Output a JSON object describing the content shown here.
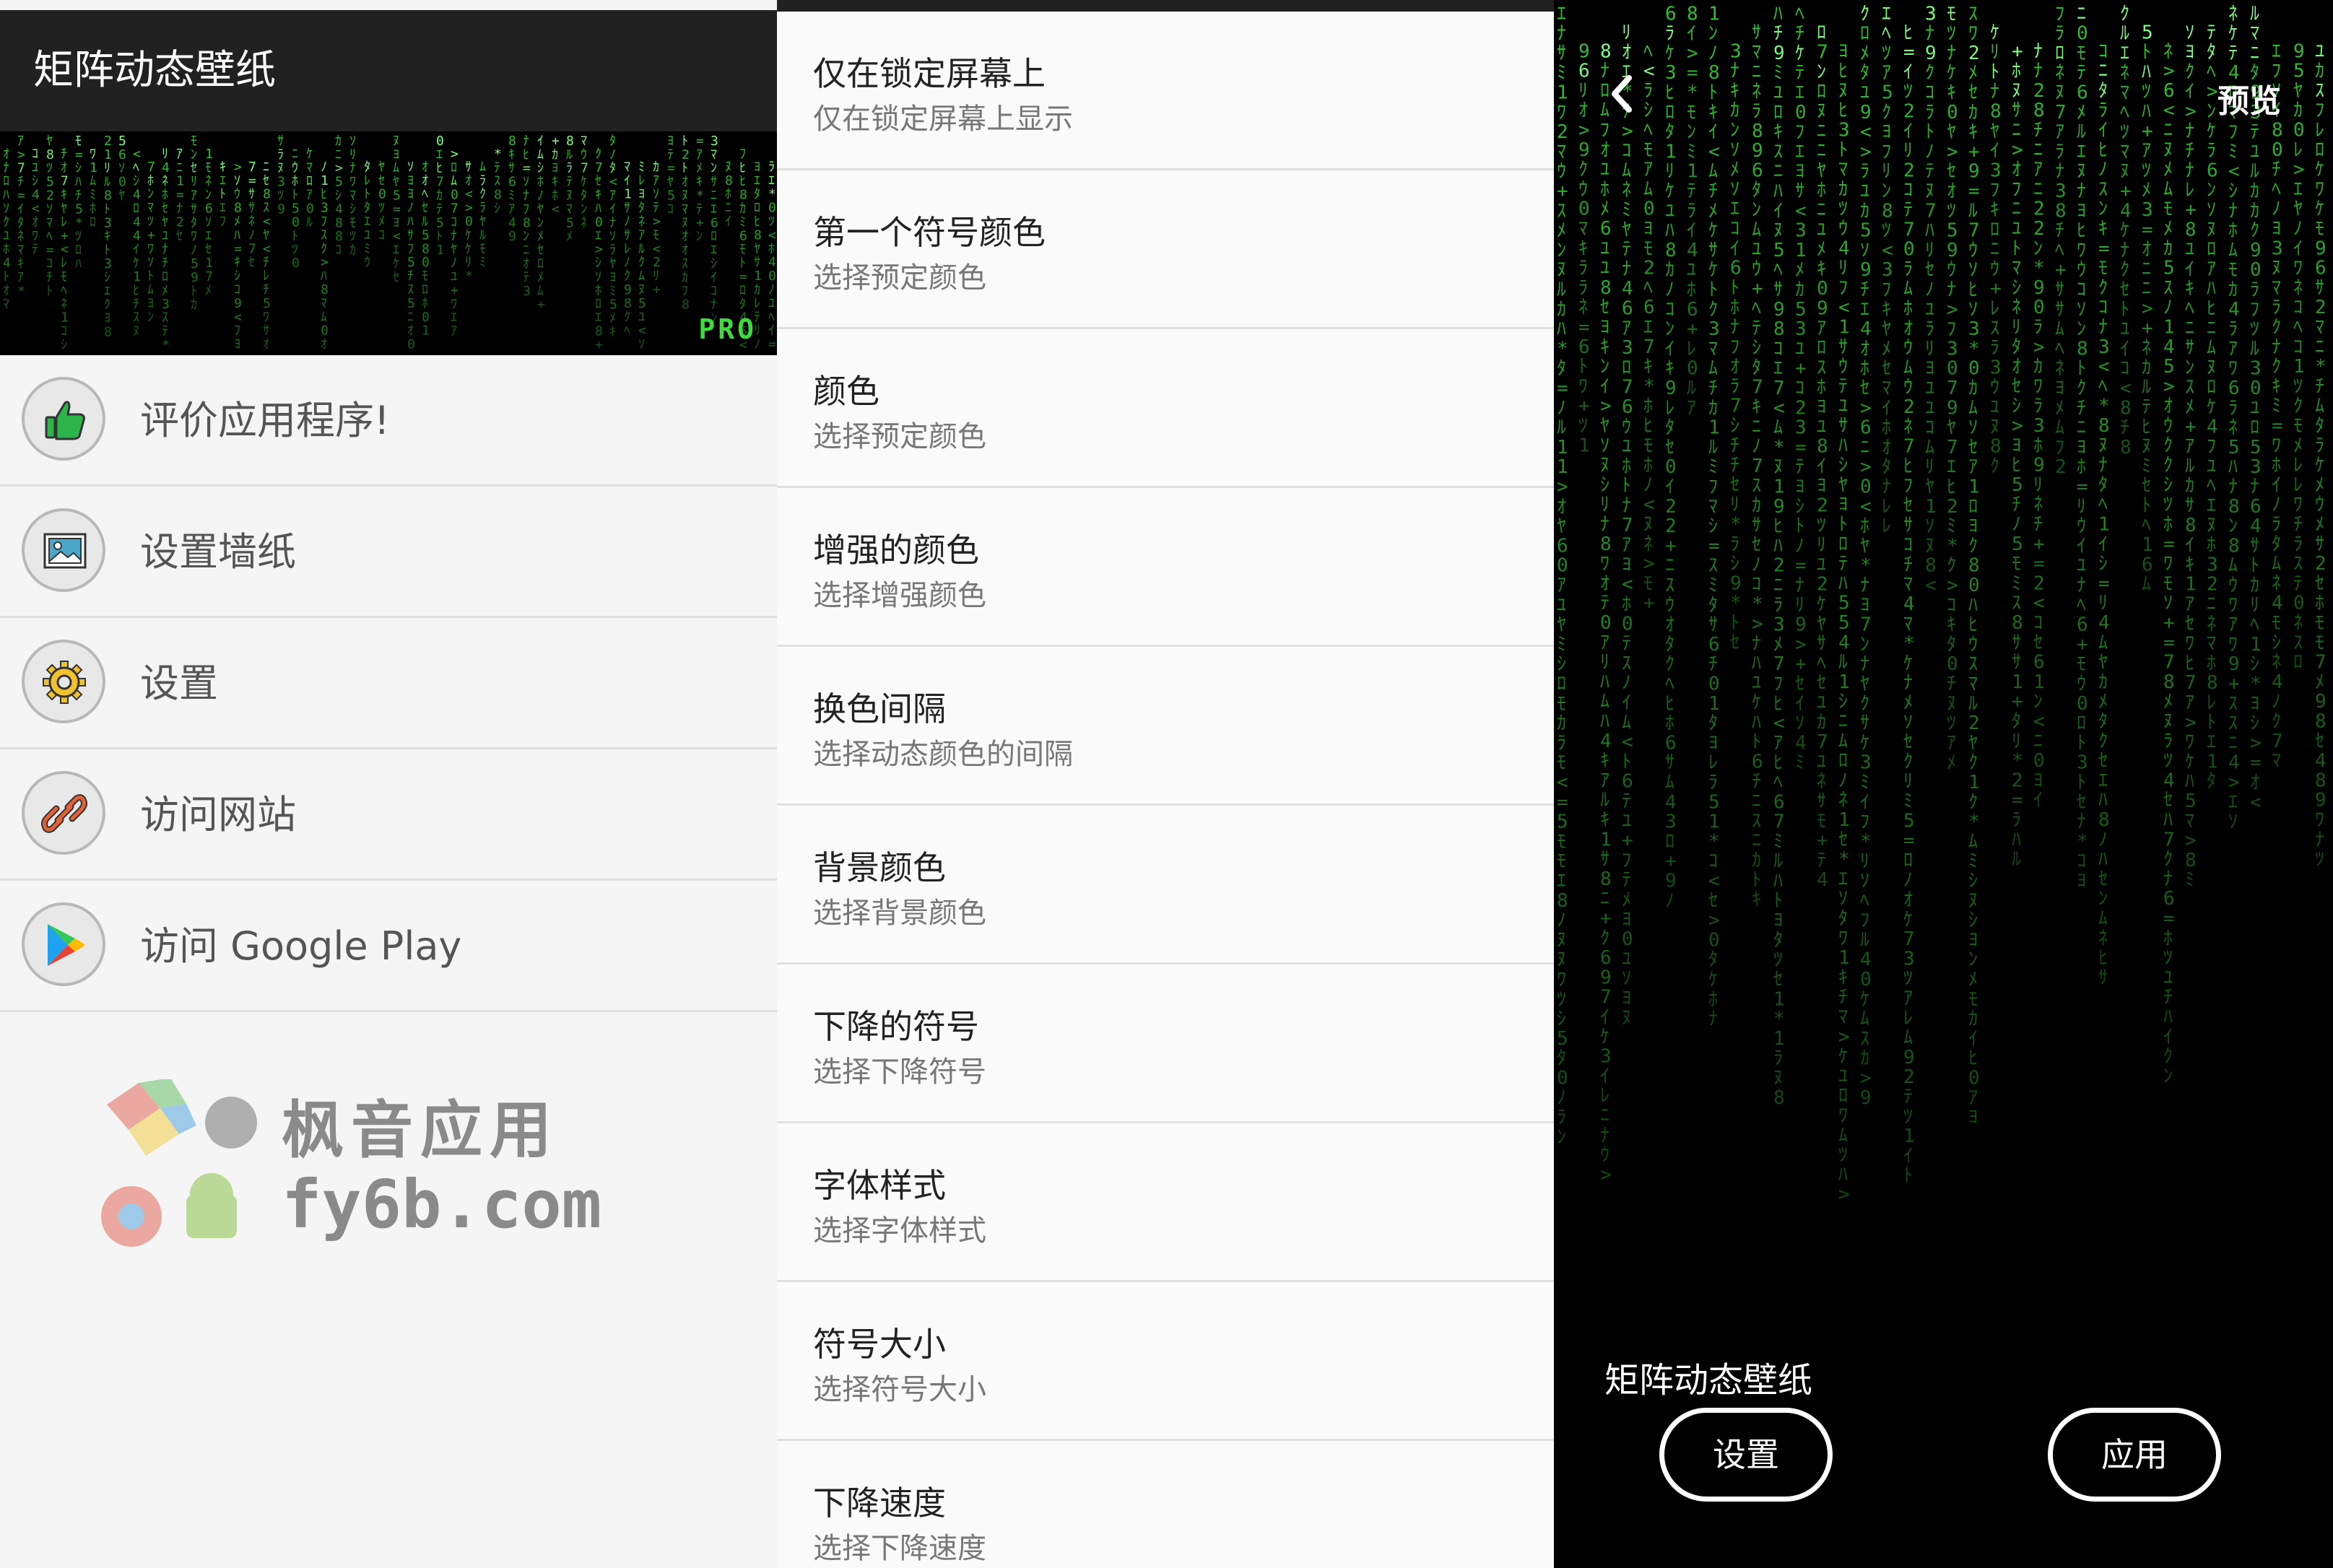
{
  "menu_screen": {
    "app_title": "矩阵动态壁纸",
    "banner_badge": "PRO",
    "items": [
      {
        "label": "评价应用程序!",
        "icon": "thumbs-up-icon"
      },
      {
        "label": "设置墙纸",
        "icon": "image-icon"
      },
      {
        "label": "设置",
        "icon": "gear-icon"
      },
      {
        "label": "访问网站",
        "icon": "link-icon"
      },
      {
        "label": "访问 Google Play",
        "icon": "google-play-icon"
      }
    ],
    "watermark": {
      "title": "枫音应用",
      "site": "fy6b.com"
    }
  },
  "settings_screen": {
    "rows": [
      {
        "title": "仅在锁定屏幕上",
        "subtitle": "仅在锁定屏幕上显示"
      },
      {
        "title": "第一个符号颜色",
        "subtitle": "选择预定颜色"
      },
      {
        "title": "颜色",
        "subtitle": "选择预定颜色"
      },
      {
        "title": "增强的颜色",
        "subtitle": "选择增强颜色"
      },
      {
        "title": "换色间隔",
        "subtitle": "选择动态颜色的间隔"
      },
      {
        "title": "背景颜色",
        "subtitle": "选择背景颜色"
      },
      {
        "title": "下降的符号",
        "subtitle": "选择下降符号"
      },
      {
        "title": "字体样式",
        "subtitle": "选择字体样式"
      },
      {
        "title": "符号大小",
        "subtitle": "选择符号大小"
      },
      {
        "title": "下降速度",
        "subtitle": "选择下降速度"
      }
    ]
  },
  "preview_screen": {
    "title": "预览",
    "wallpaper_name": "矩阵动态壁纸",
    "settings_button": "设置",
    "apply_button": "应用"
  },
  "colors": {
    "appbar": "#212121",
    "matrix_green": "#3ddc3d",
    "menu_background": "#f5f5f5",
    "divider": "#e0e0e0"
  }
}
